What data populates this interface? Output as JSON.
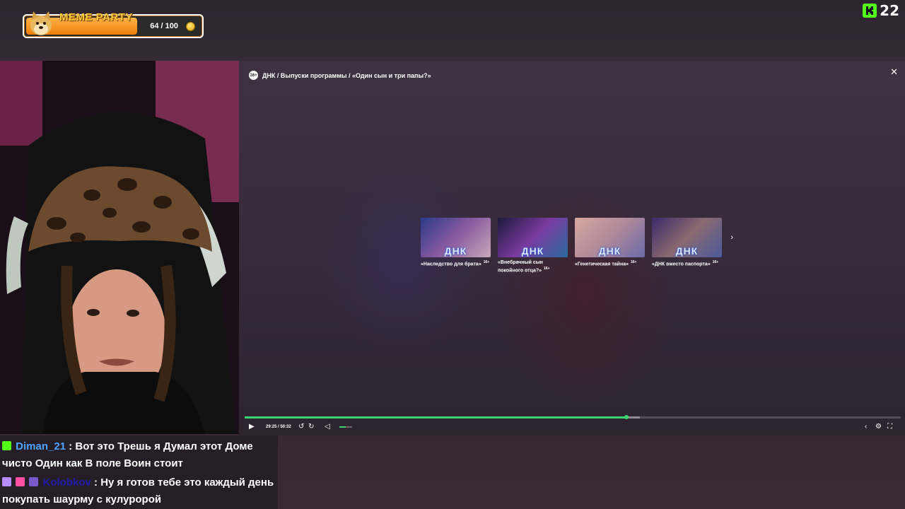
{
  "overlay": {
    "meme_party": {
      "title": "MEME PARTY",
      "count": "64 / 100",
      "progress": 0.64
    },
    "platform_badge": {
      "count": "22"
    }
  },
  "player": {
    "breadcrumb": "ДНК / Выпуски программы / «Один сын и три папы?»",
    "age_rating": "16+",
    "time": "29:25 / 50:32",
    "progress": 0.582,
    "buffered": 0.602,
    "volume": 0.5,
    "recommendations": [
      {
        "title": "«Наследство для брата»",
        "rating": "16+",
        "logo": "ДНК"
      },
      {
        "title": "«Внебрачный сын покойного отца?»",
        "rating": "16+",
        "logo": "ДНК"
      },
      {
        "title": "«Генетическая тайна»",
        "rating": "16+",
        "logo": "ДНК"
      },
      {
        "title": "«ДНК вместо паспорта»",
        "rating": "16+",
        "logo": "ДНК"
      }
    ]
  },
  "chat": {
    "messages": [
      {
        "user": "Diman_21",
        "text": "Вот это Трешь я Думал этот Доме чисто Один как В поле Воин стоит"
      },
      {
        "user": "Kolobkov",
        "text": "Ну я готов тебе это каждый день покупать шаурму с кулуророй"
      }
    ]
  },
  "colors": {
    "accent_green": "#3ed36e",
    "kick_green": "#53fc18",
    "meme_orange": "#f07e0a"
  }
}
